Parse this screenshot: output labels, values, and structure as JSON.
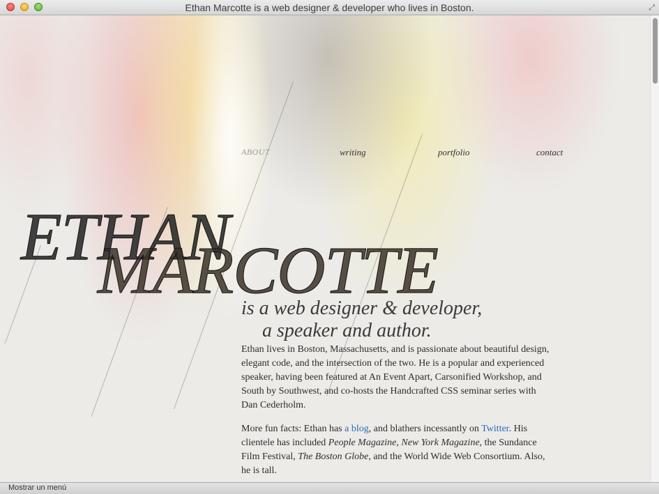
{
  "window": {
    "title": "Ethan Marcotte is a web designer & developer who lives in Boston.",
    "fullscreen_icon": "fullscreen-arrows-icon",
    "accent_progress_color": "#e07a3c"
  },
  "nav": {
    "items": [
      {
        "label": "ABOUT",
        "active": true
      },
      {
        "label": "writing",
        "active": false
      },
      {
        "label": "portfolio",
        "active": false
      },
      {
        "label": "contact",
        "active": false
      }
    ]
  },
  "hero": {
    "first_name": "ETHAN",
    "last_name": "MARCOTTE",
    "tagline_line1": "is a web designer & developer,",
    "tagline_line2": "a speaker and author."
  },
  "bio": {
    "paragraph1": "Ethan lives in Boston, Massachusetts, and is passionate about beautiful design, elegant code, and the intersection of the two. He is a popular and experienced speaker, having been featured at An Event Apart, Carsonified Workshop, and South by Southwest, and co-hosts the Handcrafted CSS seminar series with Dan Cederholm.",
    "p2_a": "More fun facts: Ethan has ",
    "p2_link_blog": "a blog",
    "p2_b": ", and blathers incessantly on ",
    "p2_link_twitter": "Twitter",
    "p2_c": ". His clientele has included ",
    "p2_people": "People Magazine",
    "p2_d": ", ",
    "p2_nym": "New York Magazine",
    "p2_e": ", the Sundance Film Festival, ",
    "p2_globe": "The Boston Globe",
    "p2_f": ", and the World Wide Web Consortium. Also, he is tall."
  },
  "status_bar": {
    "text": "Mostrar un menú"
  },
  "colors": {
    "link": "#2a6ab8",
    "nav_active": "#9a9a9a"
  }
}
